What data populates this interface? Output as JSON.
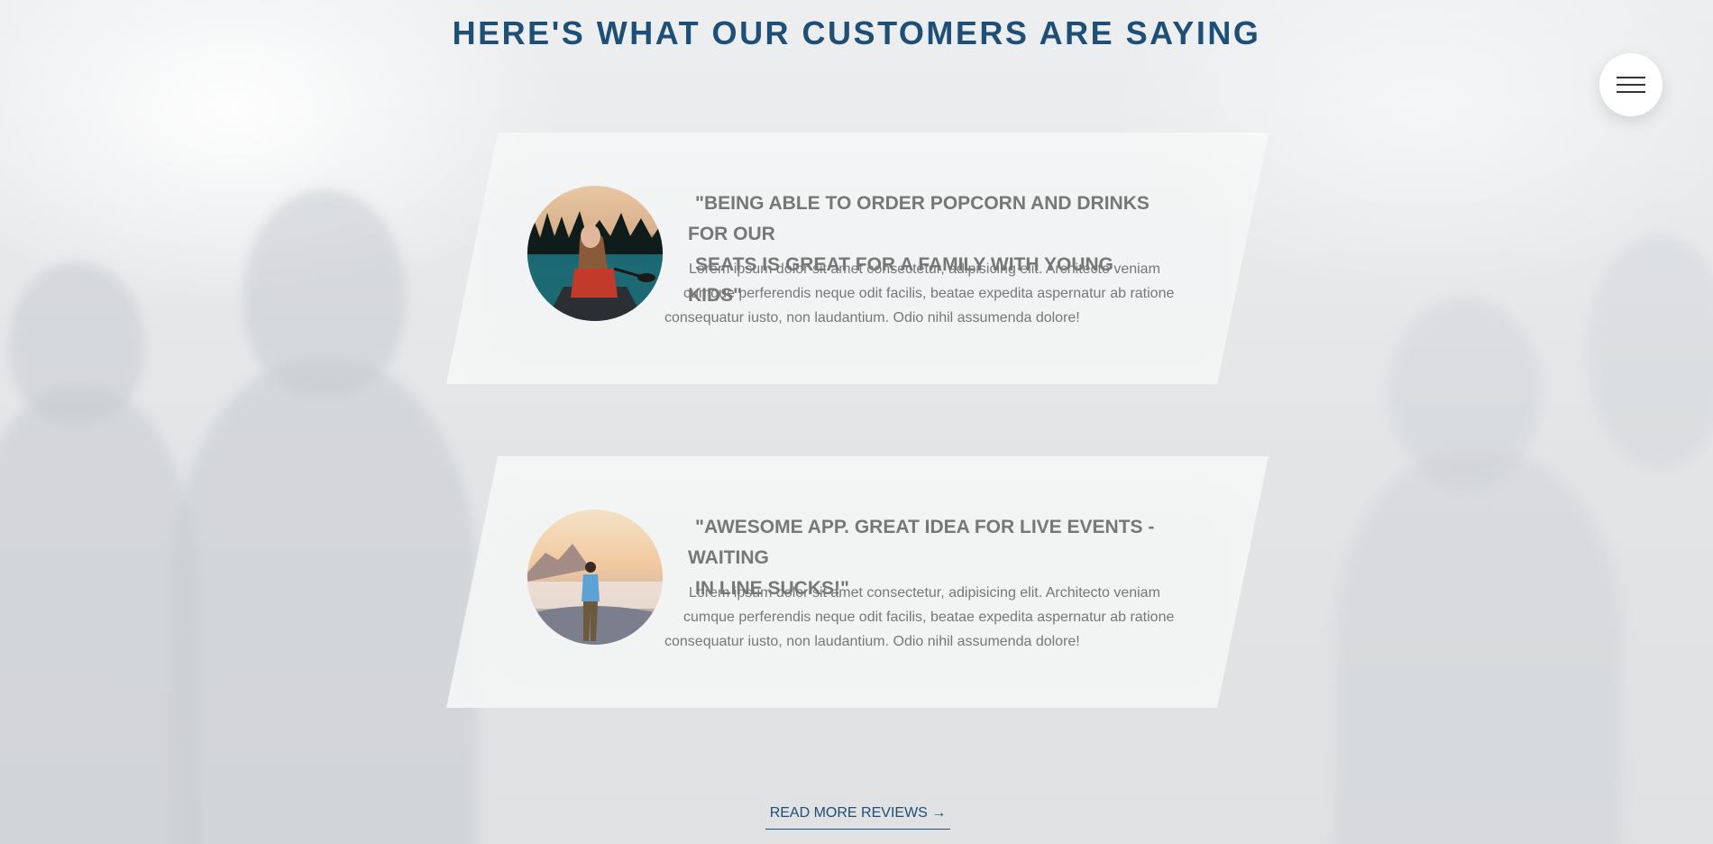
{
  "section": {
    "title": "HERE'S WHAT OUR CUSTOMERS ARE SAYING"
  },
  "reviews": [
    {
      "quote_line1": "\"BEING ABLE TO ORDER POPCORN AND DRINKS FOR OUR",
      "quote_line2": "SEATS IS GREAT FOR A FAMILY WITH YOUNG KIDS\"",
      "body_line1": "Lorem ipsum dolor sit amet consectetur, adipisicing elit. Architecto veniam",
      "body_line2": "cumque perferendis neque odit facilis, beatae expedita aspernatur ab ratione",
      "body_line3": "consequatur iusto, non laudantium. Odio nihil assumenda dolore!",
      "avatar_icon": "woman-in-canoe-photo"
    },
    {
      "quote_line1": "\"AWESOME APP. GREAT IDEA FOR LIVE EVENTS - WAITING",
      "quote_line2": "IN LINE SUCKS!\"",
      "body_line1": "Lorem ipsum dolor sit amet consectetur, adipisicing elit. Architecto veniam",
      "body_line2": "cumque perferendis neque odit facilis, beatae expedita aspernatur ab ratione",
      "body_line3": "consequatur iusto, non laudantium. Odio nihil assumenda dolore!",
      "avatar_icon": "man-on-mountain-photo"
    }
  ],
  "cta": {
    "read_more": "READ MORE REVIEWS →"
  },
  "menu": {
    "icon": "hamburger-menu-icon"
  },
  "colors": {
    "heading": "#1e4f77",
    "card_text": "#777777",
    "card_bg": "#f6f7f7"
  }
}
